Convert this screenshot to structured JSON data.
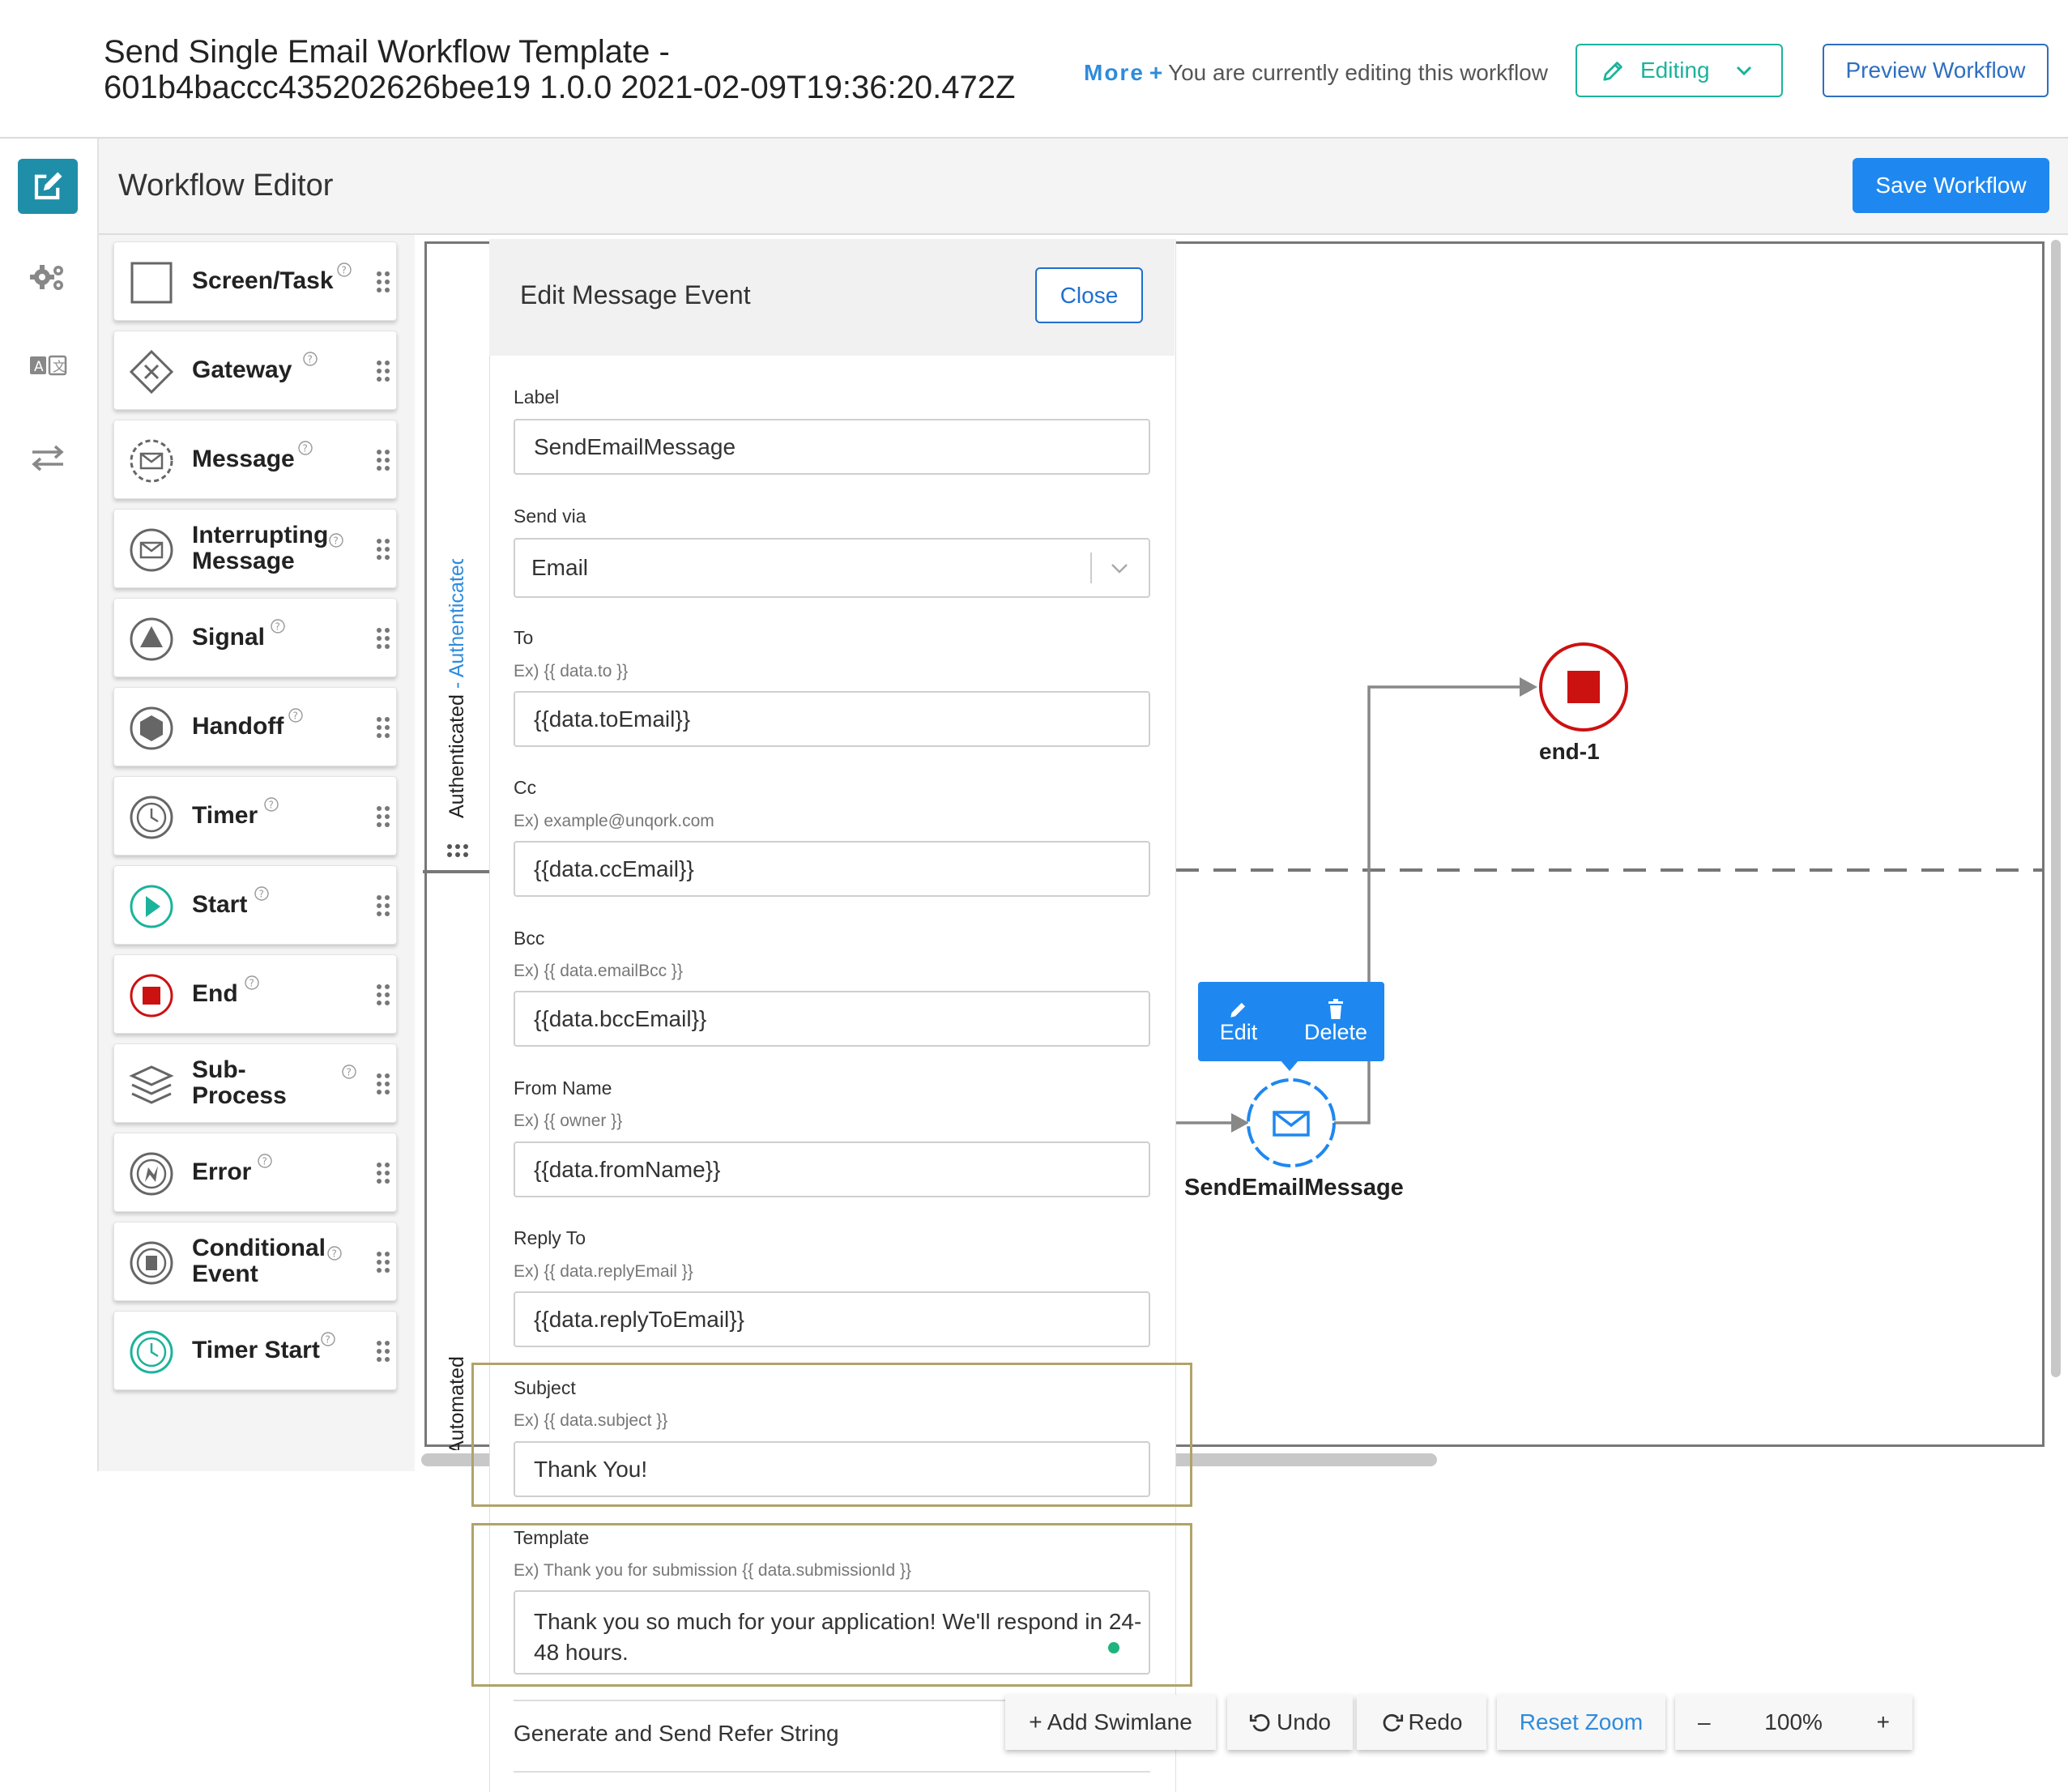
{
  "header": {
    "title": "Send Single Email Workflow Template - 601b4baccc435202626bee19 1.0.0 2021-02-09T19:36:20.472Z",
    "more_label": "More",
    "more_plus": "+",
    "edit_note": "You are currently editing this workflow",
    "editing_label": "Editing",
    "preview_label": "Preview Workflow"
  },
  "editor": {
    "title": "Workflow Editor",
    "save_label": "Save Workflow"
  },
  "palette": {
    "items": [
      {
        "label": "Screen/Task",
        "icon": "square-icon"
      },
      {
        "label": "Gateway",
        "icon": "diamond-x-icon"
      },
      {
        "label": "Message",
        "icon": "message-dashed-icon"
      },
      {
        "label": "Interrupting Message",
        "icon": "message-circle-icon"
      },
      {
        "label": "Signal",
        "icon": "triangle-circle-icon"
      },
      {
        "label": "Handoff",
        "icon": "hexagon-circle-icon"
      },
      {
        "label": "Timer",
        "icon": "clock-icon"
      },
      {
        "label": "Start",
        "icon": "play-circle-icon"
      },
      {
        "label": "End",
        "icon": "stop-circle-icon"
      },
      {
        "label": "Sub-Process",
        "icon": "layers-icon"
      },
      {
        "label": "Error",
        "icon": "bolt-circle-icon"
      },
      {
        "label": "Conditional Event",
        "icon": "conditional-circle-icon"
      },
      {
        "label": "Timer Start",
        "icon": "clock-start-icon"
      }
    ]
  },
  "lanes": {
    "lane1": "Authenticated - Authenticated",
    "lane2": "Automated"
  },
  "panel": {
    "title": "Edit Message Event",
    "close_label": "Close",
    "label_label": "Label",
    "label_value": "SendEmailMessage",
    "sendvia_label": "Send via",
    "sendvia_value": "Email",
    "to_label": "To",
    "to_hint": "Ex) {{ data.to }}",
    "to_value": "{{data.toEmail}}",
    "cc_label": "Cc",
    "cc_hint": "Ex) example@unqork.com",
    "cc_value": "{{data.ccEmail}}",
    "bcc_label": "Bcc",
    "bcc_hint": "Ex) {{ data.emailBcc }}",
    "bcc_value": "{{data.bccEmail}}",
    "fromname_label": "From Name",
    "fromname_hint": "Ex) {{ owner }}",
    "fromname_value": "{{data.fromName}}",
    "replyto_label": "Reply To",
    "replyto_hint": "Ex) {{ data.replyEmail }}",
    "replyto_value": "{{data.replyToEmail}}",
    "subject_label": "Subject",
    "subject_hint": "Ex) {{ data.subject }}",
    "subject_value": "Thank You!",
    "template_label": "Template",
    "template_hint": "Ex) Thank you for submission {{ data.submissionId }}",
    "template_value": "Thank you so much for your application! We'll respond in 24-48 hours.",
    "refer_label": "Generate and Send Refer String"
  },
  "diagram": {
    "end_label": "end-1",
    "message_label": "SendEmailMessage",
    "edit_label": "Edit",
    "delete_label": "Delete"
  },
  "toolbar": {
    "add_swimlane": "+ Add Swimlane",
    "undo": "Undo",
    "redo": "Redo",
    "reset_zoom": "Reset Zoom",
    "zoom_out": "–",
    "zoom_value": "100%",
    "zoom_in": "+"
  },
  "colors": {
    "accent_teal": "#1bb39b",
    "primary_blue": "#1e88f0",
    "end_red": "#cc1111",
    "highlight": "#b0a36a"
  }
}
